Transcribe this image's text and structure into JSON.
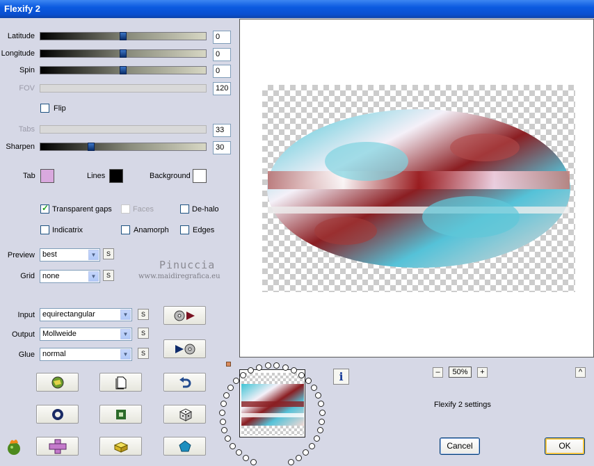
{
  "window": {
    "title": "Flexify 2"
  },
  "sliders": [
    {
      "label": "Latitude",
      "value": "0",
      "level": 0.5,
      "enabled": true
    },
    {
      "label": "Longitude",
      "value": "0",
      "level": 0.5,
      "enabled": true
    },
    {
      "label": "Spin",
      "value": "0",
      "level": 0.5,
      "enabled": true
    },
    {
      "label": "FOV",
      "value": "120",
      "enabled": false
    },
    {
      "label": "Tabs",
      "value": "33",
      "enabled": false
    },
    {
      "label": "Sharpen",
      "value": "30",
      "level": 0.3,
      "enabled": true
    }
  ],
  "flip": {
    "label": "Flip",
    "checked": false
  },
  "colors": {
    "tab": {
      "label": "Tab",
      "color": "#d9a9de"
    },
    "lines": {
      "label": "Lines",
      "color": "#000000"
    },
    "background": {
      "label": "Background",
      "color": "#ffffff"
    }
  },
  "checkboxes": {
    "transparent_gaps": {
      "label": "Transparent gaps",
      "checked": true
    },
    "faces": {
      "label": "Faces",
      "checked": false,
      "enabled": false
    },
    "de_halo": {
      "label": "De-halo",
      "checked": false
    },
    "indicatrix": {
      "label": "Indicatrix",
      "checked": false
    },
    "anamorph": {
      "label": "Anamorph",
      "checked": false
    },
    "edges": {
      "label": "Edges",
      "checked": false
    }
  },
  "preview_select": {
    "label": "Preview",
    "value": "best"
  },
  "grid_select": {
    "label": "Grid",
    "value": "none"
  },
  "watermark": {
    "name": "Pinuccia",
    "site": "www.maidiregrafica.eu"
  },
  "input_select": {
    "label": "Input",
    "value": "equirectangular"
  },
  "output_select": {
    "label": "Output",
    "value": "Mollweide"
  },
  "glue_select": {
    "label": "Glue",
    "value": "normal"
  },
  "small_button": "S",
  "zoom": {
    "value": "50%",
    "minus": "–",
    "plus": "+"
  },
  "settings_caption": "Flexify 2 settings",
  "buttons": {
    "cancel": "Cancel",
    "ok": "OK"
  },
  "info_icon": "i",
  "up_icon": "^"
}
